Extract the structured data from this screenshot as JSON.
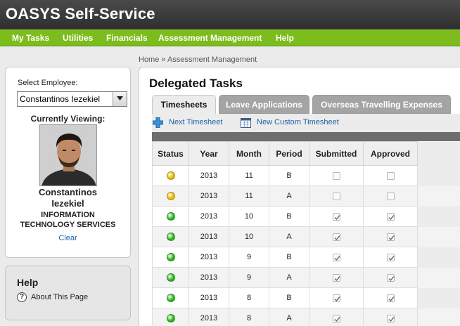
{
  "app": {
    "title": "OASYS Self-Service"
  },
  "nav": {
    "items": [
      {
        "label": "My Tasks"
      },
      {
        "label": "Utilities"
      },
      {
        "label": "Financials"
      },
      {
        "label": "Assessment Management"
      },
      {
        "label": "Help"
      }
    ]
  },
  "breadcrumb": {
    "text": "Home » Assessment Management"
  },
  "employee": {
    "select_label": "Select Employee:",
    "selected": "Constantinos Iezekiel",
    "viewing_label": "Currently Viewing:",
    "name_line1": "Constantinos",
    "name_line2": "Iezekiel",
    "dept_line1": "INFORMATION",
    "dept_line2": "TECHNOLOGY SERVICES",
    "clear_label": "Clear"
  },
  "help": {
    "title": "Help",
    "icon": "question-icon",
    "link_label": "About This Page"
  },
  "main": {
    "title": "Delegated Tasks",
    "tabs": [
      {
        "label": "Timesheets",
        "active": true
      },
      {
        "label": "Leave Applications",
        "active": false
      },
      {
        "label": "Overseas Travelling Expenses",
        "active": false
      }
    ],
    "toolbar": {
      "next_label": "Next Timesheet",
      "next_icon": "plus-icon",
      "custom_label": "New Custom Timesheet",
      "custom_icon": "calendar-icon"
    }
  },
  "grid": {
    "columns": [
      "Status",
      "Year",
      "Month",
      "Period",
      "Submitted",
      "Approved"
    ],
    "status_colors": {
      "pending": "#e8b800",
      "approved": "#2cb51a"
    },
    "rows": [
      {
        "status": "pending",
        "year": "2013",
        "month": "11",
        "period": "B",
        "submitted": false,
        "approved": false
      },
      {
        "status": "pending",
        "year": "2013",
        "month": "11",
        "period": "A",
        "submitted": false,
        "approved": false
      },
      {
        "status": "approved",
        "year": "2013",
        "month": "10",
        "period": "B",
        "submitted": true,
        "approved": true
      },
      {
        "status": "approved",
        "year": "2013",
        "month": "10",
        "period": "A",
        "submitted": true,
        "approved": true
      },
      {
        "status": "approved",
        "year": "2013",
        "month": "9",
        "period": "B",
        "submitted": true,
        "approved": true
      },
      {
        "status": "approved",
        "year": "2013",
        "month": "9",
        "period": "A",
        "submitted": true,
        "approved": true
      },
      {
        "status": "approved",
        "year": "2013",
        "month": "8",
        "period": "B",
        "submitted": true,
        "approved": true
      },
      {
        "status": "approved",
        "year": "2013",
        "month": "8",
        "period": "A",
        "submitted": true,
        "approved": true
      }
    ]
  }
}
